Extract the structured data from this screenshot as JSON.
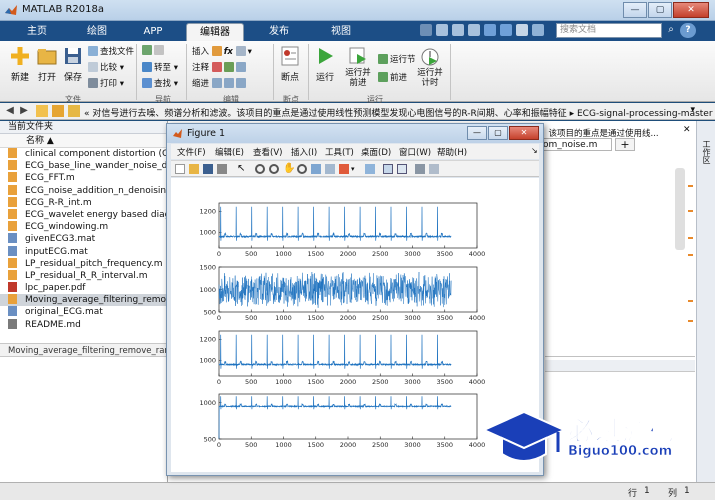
{
  "app": {
    "title": "MATLAB R2018a"
  },
  "ribbon_tabs": [
    "主页",
    "绘图",
    "APP",
    "编辑器",
    "发布",
    "视图"
  ],
  "search": {
    "placeholder": "搜索文档"
  },
  "ribbon": {
    "new": "新建",
    "open": "打开",
    "save": "保存",
    "find_file": "查找文件",
    "compare": "比较",
    "print": "打印",
    "goto": "转至",
    "find": "查找",
    "insert": "插入",
    "comment": "注释",
    "indent": "缩进",
    "breakpoint": "断点",
    "run": "运行",
    "run_advance": "运行并前进",
    "run_section": "运行节",
    "advance": "前进",
    "run_time": "运行并计时",
    "groups": {
      "file": "文件",
      "nav": "导航",
      "edit": "编辑",
      "bp": "断点",
      "run": "运行"
    }
  },
  "address": {
    "path": "« 对信号进行去噪、频谱分析和滤波。该项目的重点是通过使用线性预测模型发现心电图信号的R-R间期、心率和振幅特征 ▸ ECG-signal-processing-master"
  },
  "current_folder": {
    "header": "当前文件夹",
    "name_col": "名称 ▲",
    "files": [
      {
        "name": "clinical component distortion (CC...",
        "type": "m"
      },
      {
        "name": "ECG_base_line_wander_noise_den...",
        "type": "m"
      },
      {
        "name": "ECG_FFT.m",
        "type": "m"
      },
      {
        "name": "ECG_noise_addition_n_denoising.m",
        "type": "m"
      },
      {
        "name": "ECG_R-R_int.m",
        "type": "m"
      },
      {
        "name": "ECG_wavelet energy based diagn...",
        "type": "m"
      },
      {
        "name": "ECG_windowing.m",
        "type": "m"
      },
      {
        "name": "givenECG3.mat",
        "type": "mat"
      },
      {
        "name": "inputECG.mat",
        "type": "mat"
      },
      {
        "name": "LP_residual_pitch_frequency.m",
        "type": "m"
      },
      {
        "name": "LP_residual_R_R_interval.m",
        "type": "m"
      },
      {
        "name": "lpc_paper.pdf",
        "type": "pdf"
      },
      {
        "name": "Moving_average_filtering_remove...",
        "type": "m",
        "selected": true
      },
      {
        "name": "original_ECG.mat",
        "type": "mat"
      },
      {
        "name": "README.md",
        "type": "md"
      }
    ],
    "details": "Moving_average_filtering_remove_ran..."
  },
  "editor": {
    "description": "、该项目的重点是通过使用线...",
    "tab": "om_noise.m",
    "workspace_label": "工作区"
  },
  "status": {
    "row": "行",
    "row_val": "1",
    "col": "列",
    "col_val": "1"
  },
  "figure": {
    "title": "Figure 1",
    "menus": [
      "文件(F)",
      "编辑(E)",
      "查看(V)",
      "插入(I)",
      "工具(T)",
      "桌面(D)",
      "窗口(W)",
      "帮助(H)"
    ]
  },
  "chart_data": [
    {
      "type": "line",
      "x_ticks": [
        "0",
        "500",
        "1000",
        "1500",
        "2000",
        "2500",
        "3000",
        "3500",
        "4000"
      ],
      "y_ticks": [
        "1000",
        "1200"
      ],
      "xlim": [
        0,
        4000
      ],
      "ylim": [
        850,
        1280
      ],
      "baseline": 960,
      "peak": 1245,
      "beats": 15
    },
    {
      "type": "line",
      "x_ticks": [
        "0",
        "500",
        "1000",
        "1500",
        "2000",
        "2500",
        "3000",
        "3500",
        "4000"
      ],
      "y_ticks": [
        "500",
        "1000",
        "1500"
      ],
      "xlim": [
        0,
        4000
      ],
      "ylim": [
        500,
        1500
      ],
      "baseline": 1000,
      "noise": true
    },
    {
      "type": "line",
      "x_ticks": [
        "0",
        "500",
        "1000",
        "1500",
        "2000",
        "2500",
        "3000",
        "3500",
        "4000"
      ],
      "y_ticks": [
        "1000",
        "1200"
      ],
      "xlim": [
        0,
        4000
      ],
      "ylim": [
        850,
        1280
      ],
      "baseline": 960,
      "peak": 1245,
      "beats": 15
    },
    {
      "type": "line",
      "x_ticks": [
        "0",
        "500",
        "1000",
        "1500",
        "2000",
        "2500",
        "3000",
        "3500",
        "4000"
      ],
      "y_ticks": [
        "500",
        "1000"
      ],
      "xlim": [
        0,
        4000
      ],
      "ylim": [
        500,
        1120
      ],
      "baseline": 950,
      "peak": 1090,
      "beats": 15
    }
  ],
  "watermark": {
    "cn": "必过源码",
    "en": "Biguo100.com"
  }
}
